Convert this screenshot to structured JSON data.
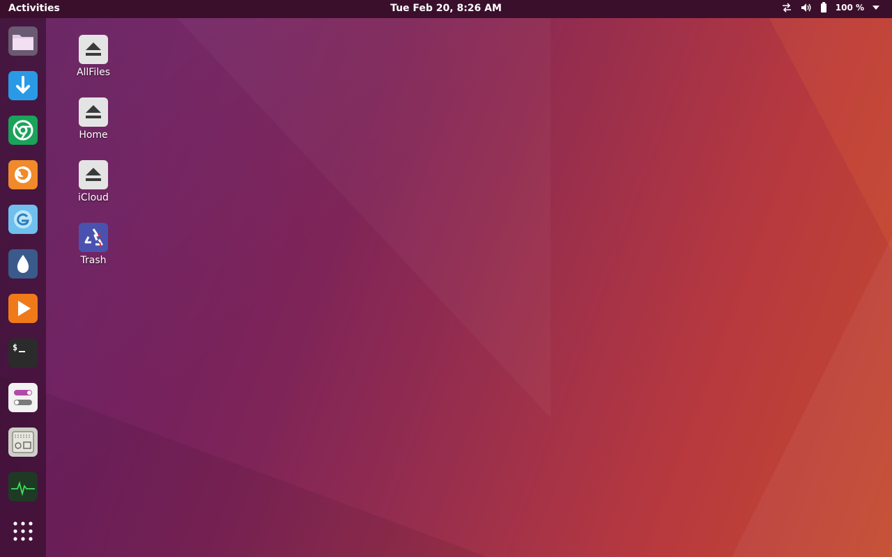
{
  "topbar": {
    "activities_label": "Activities",
    "clock": "Tue Feb 20,  8:26 AM",
    "battery_percent": "100 %",
    "icons": [
      "network-arrows-icon",
      "volume-icon",
      "battery-icon",
      "system-menu-arrow-icon"
    ]
  },
  "dock": {
    "items": [
      {
        "id": "files",
        "icon": "folder-icon"
      },
      {
        "id": "downloader",
        "icon": "download-arrow-icon"
      },
      {
        "id": "chrome",
        "icon": "chrome-icon"
      },
      {
        "id": "firefox",
        "icon": "firefox-icon"
      },
      {
        "id": "browser",
        "icon": "web-browser-icon"
      },
      {
        "id": "drop",
        "icon": "water-drop-icon"
      },
      {
        "id": "media-player",
        "icon": "play-icon"
      },
      {
        "id": "terminal",
        "icon": "terminal-icon"
      },
      {
        "id": "settings",
        "icon": "toggle-settings-icon"
      },
      {
        "id": "system-tool",
        "icon": "hardware-panel-icon"
      },
      {
        "id": "system-monitor",
        "icon": "heartbeat-monitor-icon"
      },
      {
        "id": "show-apps",
        "icon": "app-grid-icon"
      }
    ]
  },
  "desktop": {
    "items": [
      {
        "label": "AllFiles",
        "icon": "eject-drive-icon"
      },
      {
        "label": "Home",
        "icon": "eject-drive-icon"
      },
      {
        "label": "iCloud",
        "icon": "eject-drive-icon"
      },
      {
        "label": "Trash",
        "icon": "recycle-trash-icon"
      }
    ]
  },
  "colors": {
    "topbar": "#3a0f2c",
    "wallpaper_left": "#5e1c5c",
    "wallpaper_right": "#c44a2e",
    "accent": "#f08a4b"
  },
  "terminal_prompt": "$_"
}
